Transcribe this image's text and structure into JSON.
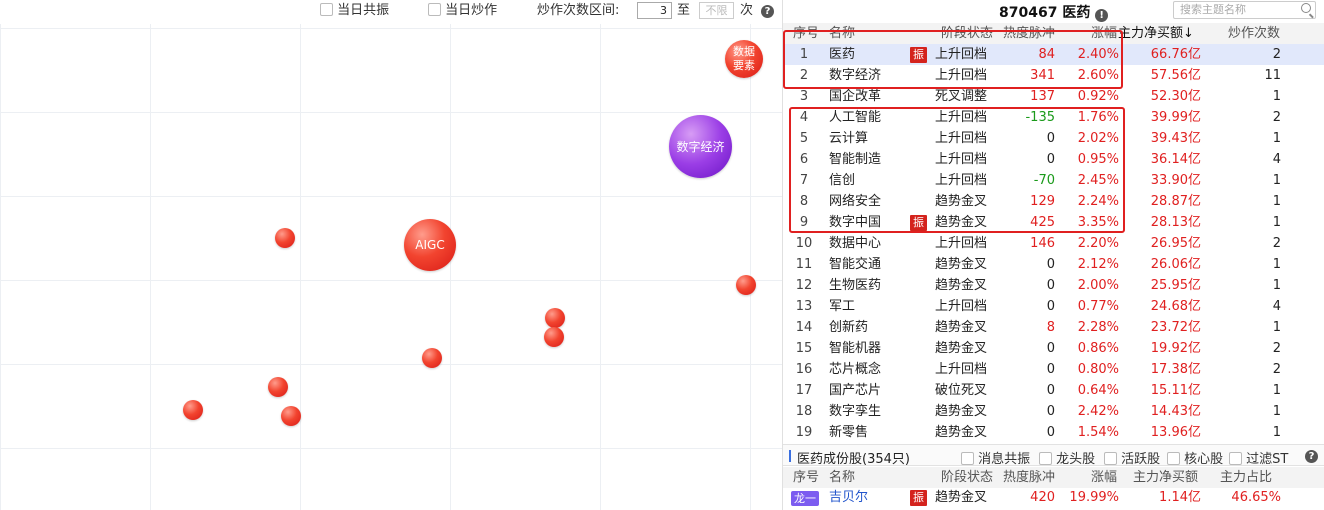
{
  "toolbar": {
    "checkbox1_label": "当日共振",
    "checkbox2_label": "当日炒作",
    "range_label": "炒作次数区间:",
    "range_from": "3",
    "range_to_word": "至",
    "range_to_placeholder": "不限",
    "range_unit": "次",
    "help_icon": "?"
  },
  "bubbles": [
    {
      "label": "数据要素",
      "color": "#e0261f"
    },
    {
      "label": "数字经济",
      "color": "#8a2be2"
    },
    {
      "label": "AIGC",
      "color": "#e0261f"
    }
  ],
  "panel": {
    "title": "870467 医药",
    "info_icon": "!",
    "search_placeholder": "搜索主题名称",
    "headers": {
      "no": "序号",
      "name": "名称",
      "stage": "阶段状态",
      "heat": "热度脉冲",
      "chg": "涨幅",
      "flow": "主力净买额↓",
      "cnt": "炒作次数"
    },
    "zhen_label": "振",
    "rows": [
      {
        "no": "1",
        "name": "医药",
        "zhen": true,
        "stage": "上升回档",
        "heat": "84",
        "heat_color": "red",
        "chg": "2.40%",
        "flow": "66.76亿",
        "cnt": "2"
      },
      {
        "no": "2",
        "name": "数字经济",
        "zhen": false,
        "stage": "上升回档",
        "heat": "341",
        "heat_color": "red",
        "chg": "2.60%",
        "flow": "57.56亿",
        "cnt": "11"
      },
      {
        "no": "3",
        "name": "国企改革",
        "zhen": false,
        "stage": "死叉调整",
        "heat": "137",
        "heat_color": "red",
        "chg": "0.92%",
        "flow": "52.30亿",
        "cnt": "1"
      },
      {
        "no": "4",
        "name": "人工智能",
        "zhen": false,
        "stage": "上升回档",
        "heat": "-135",
        "heat_color": "green",
        "chg": "1.76%",
        "flow": "39.99亿",
        "cnt": "2"
      },
      {
        "no": "5",
        "name": "云计算",
        "zhen": false,
        "stage": "上升回档",
        "heat": "0",
        "heat_color": "dark",
        "chg": "2.02%",
        "flow": "39.43亿",
        "cnt": "1"
      },
      {
        "no": "6",
        "name": "智能制造",
        "zhen": false,
        "stage": "上升回档",
        "heat": "0",
        "heat_color": "dark",
        "chg": "0.95%",
        "flow": "36.14亿",
        "cnt": "4"
      },
      {
        "no": "7",
        "name": "信创",
        "zhen": false,
        "stage": "上升回档",
        "heat": "-70",
        "heat_color": "green",
        "chg": "2.45%",
        "flow": "33.90亿",
        "cnt": "1"
      },
      {
        "no": "8",
        "name": "网络安全",
        "zhen": false,
        "stage": "趋势金叉",
        "heat": "129",
        "heat_color": "red",
        "chg": "2.24%",
        "flow": "28.87亿",
        "cnt": "1"
      },
      {
        "no": "9",
        "name": "数字中国",
        "zhen": true,
        "stage": "趋势金叉",
        "heat": "425",
        "heat_color": "red",
        "chg": "3.35%",
        "flow": "28.13亿",
        "cnt": "1"
      },
      {
        "no": "10",
        "name": "数据中心",
        "zhen": false,
        "stage": "上升回档",
        "heat": "146",
        "heat_color": "red",
        "chg": "2.20%",
        "flow": "26.95亿",
        "cnt": "2"
      },
      {
        "no": "11",
        "name": "智能交通",
        "zhen": false,
        "stage": "趋势金叉",
        "heat": "0",
        "heat_color": "dark",
        "chg": "2.12%",
        "flow": "26.06亿",
        "cnt": "1"
      },
      {
        "no": "12",
        "name": "生物医药",
        "zhen": false,
        "stage": "趋势金叉",
        "heat": "0",
        "heat_color": "dark",
        "chg": "2.00%",
        "flow": "25.95亿",
        "cnt": "1"
      },
      {
        "no": "13",
        "name": "军工",
        "zhen": false,
        "stage": "上升回档",
        "heat": "0",
        "heat_color": "dark",
        "chg": "0.77%",
        "flow": "24.68亿",
        "cnt": "4"
      },
      {
        "no": "14",
        "name": "创新药",
        "zhen": false,
        "stage": "趋势金叉",
        "heat": "8",
        "heat_color": "red",
        "chg": "2.28%",
        "flow": "23.72亿",
        "cnt": "1"
      },
      {
        "no": "15",
        "name": "智能机器",
        "zhen": false,
        "stage": "趋势金叉",
        "heat": "0",
        "heat_color": "dark",
        "chg": "0.86%",
        "flow": "19.92亿",
        "cnt": "2"
      },
      {
        "no": "16",
        "name": "芯片概念",
        "zhen": false,
        "stage": "上升回档",
        "heat": "0",
        "heat_color": "dark",
        "chg": "0.80%",
        "flow": "17.38亿",
        "cnt": "2"
      },
      {
        "no": "17",
        "name": "国产芯片",
        "zhen": false,
        "stage": "破位死叉",
        "heat": "0",
        "heat_color": "dark",
        "chg": "0.64%",
        "flow": "15.11亿",
        "cnt": "1"
      },
      {
        "no": "18",
        "name": "数字孪生",
        "zhen": false,
        "stage": "趋势金叉",
        "heat": "0",
        "heat_color": "dark",
        "chg": "2.42%",
        "flow": "14.43亿",
        "cnt": "1"
      },
      {
        "no": "19",
        "name": "新零售",
        "zhen": false,
        "stage": "趋势金叉",
        "heat": "0",
        "heat_color": "dark",
        "chg": "1.54%",
        "flow": "13.96亿",
        "cnt": "1"
      }
    ],
    "constituents": {
      "title": "医药成份股(354只)",
      "options": [
        "消息共振",
        "龙头股",
        "活跃股",
        "核心股",
        "过滤ST"
      ],
      "help_icon": "?",
      "headers": {
        "no": "序号",
        "name": "名称",
        "stage": "阶段状态",
        "heat": "热度脉冲",
        "chg": "涨幅",
        "flow": "主力净买额",
        "ratio": "主力占比"
      },
      "row": {
        "badge": "龙一",
        "name": "吉贝尔",
        "zhen": true,
        "stage": "趋势金叉",
        "heat": "420",
        "chg": "19.99%",
        "flow": "1.14亿",
        "ratio": "46.65%"
      }
    }
  }
}
